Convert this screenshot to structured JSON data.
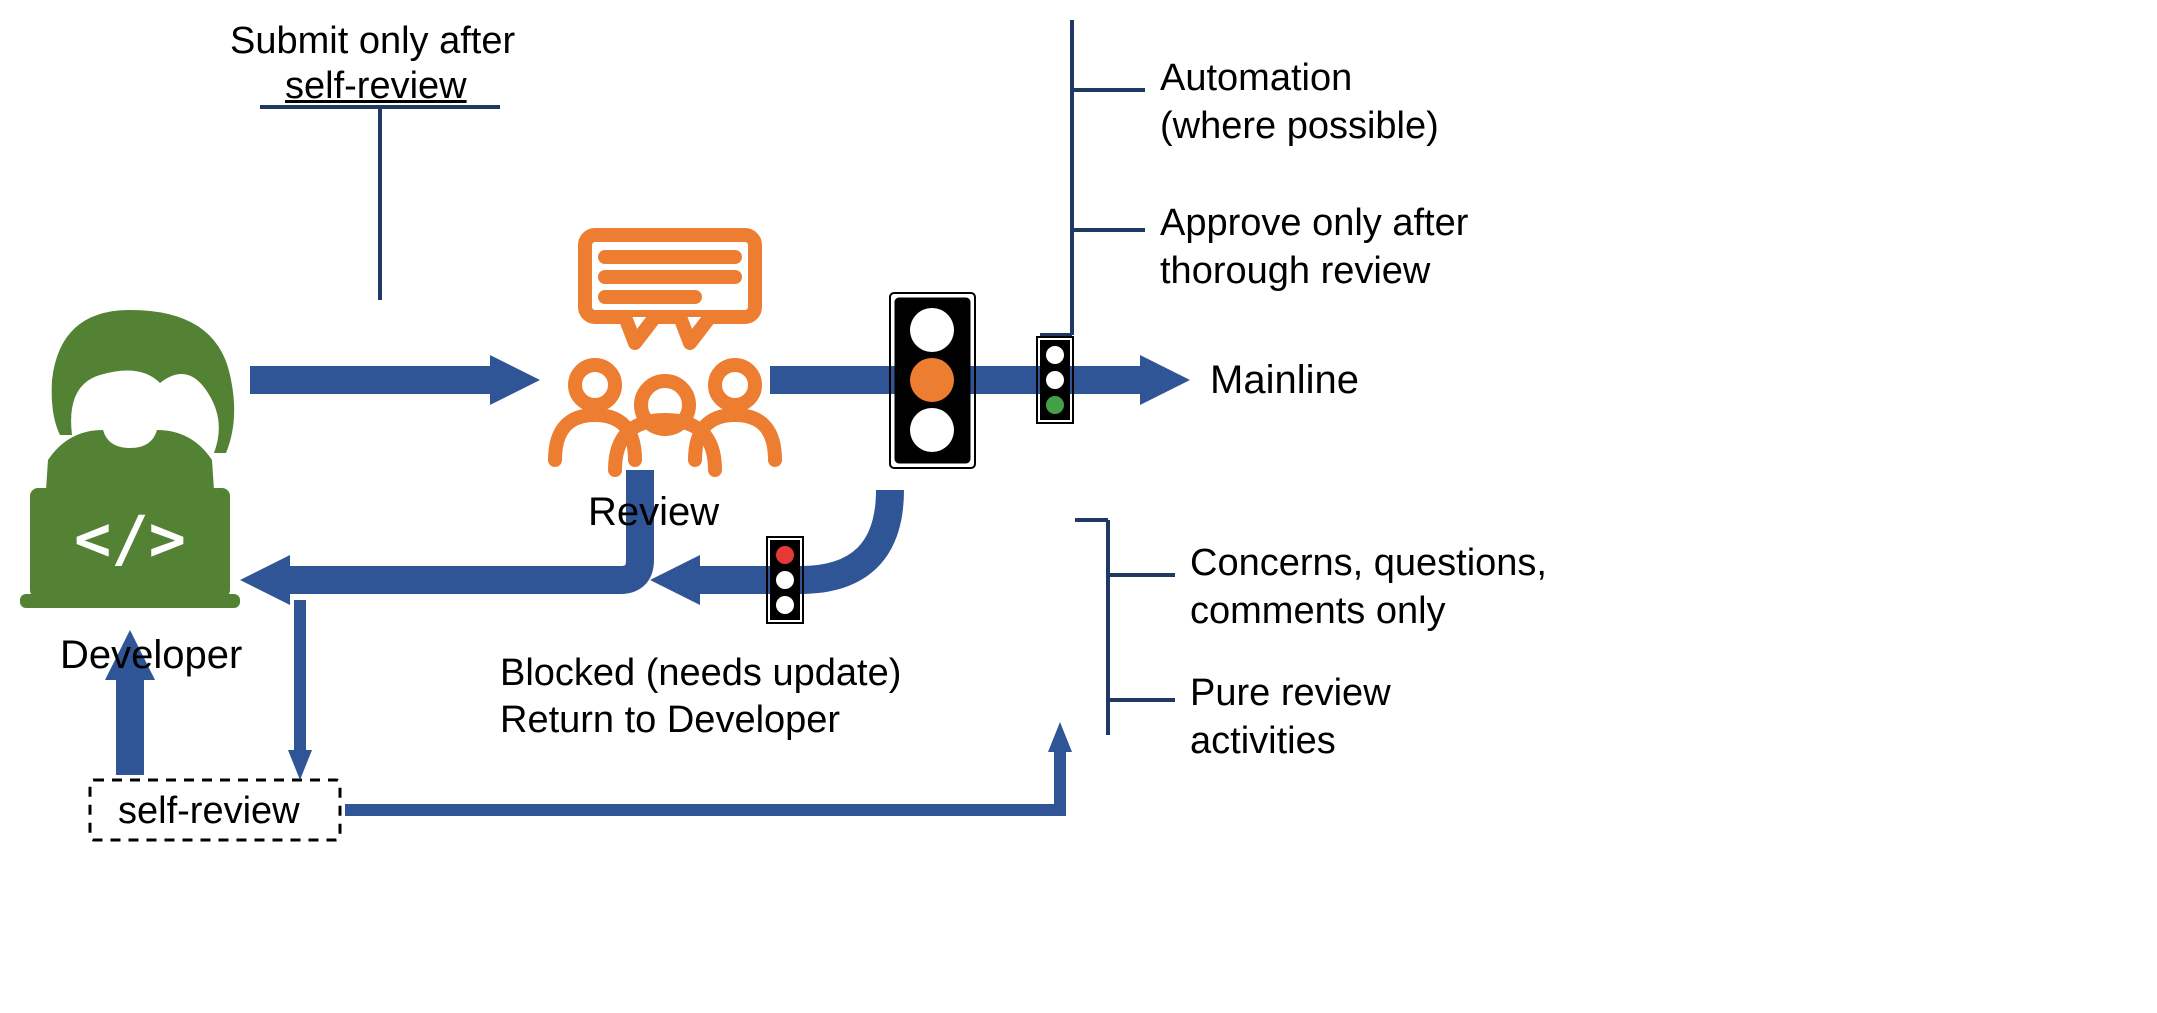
{
  "colors": {
    "arrow": "#2F5597",
    "bracket": "#1F3864",
    "dev": "#548235",
    "review": "#ED7D31",
    "red": "#E53935",
    "amber": "#ED7D31",
    "green": "#43A047",
    "white": "#FFFFFF",
    "black": "#000000"
  },
  "labels": {
    "developer": "Developer",
    "submit_only": "Submit only after",
    "self_review": "self-review",
    "self_review_box": "self-review",
    "review": "Review",
    "automation": "Automation\n(where possible)",
    "approve_only": "Approve only after\nthorough review",
    "mainline": "Mainline",
    "blocked": "Blocked (needs update)",
    "return_to": "Return to Developer",
    "concerns": "Concerns, questions,\ncomments only",
    "pure_review": "Pure review\nactivities"
  }
}
